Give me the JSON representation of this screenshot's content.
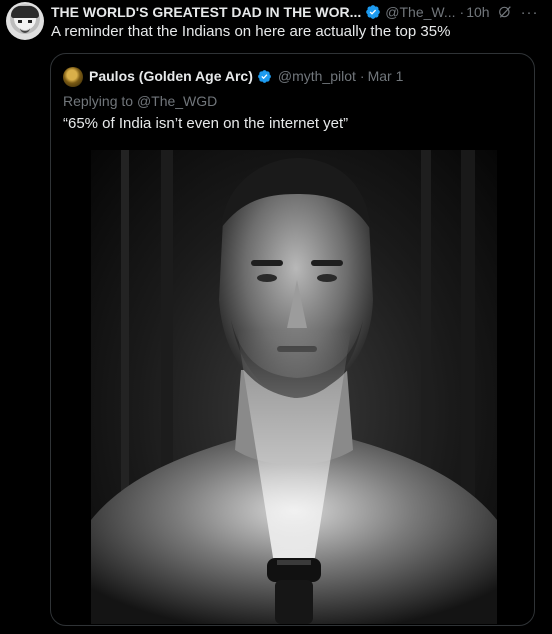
{
  "tweet": {
    "author_name": "THE WORLD'S GREATEST DAD IN THE WOR...",
    "author_handle": "@The_W...",
    "time": "10h",
    "text": "A reminder that the Indians on here are actually the top 35%",
    "more_label": "···"
  },
  "quoted": {
    "author_name": "Paulos (Golden Age Arc)",
    "author_handle": "@myth_pilot",
    "date": "Mar 1",
    "replying_prefix": "Replying to",
    "replying_handle": "@The_WGD",
    "text": "“65% of India isn’t even on the internet yet”"
  },
  "colors": {
    "background": "#000000",
    "text": "#e7e9ea",
    "secondary": "#71767b",
    "verified": "#1d9bf0",
    "border": "#2f3336"
  },
  "icons": [
    "verified-badge-icon",
    "grok-icon",
    "more-icon"
  ]
}
